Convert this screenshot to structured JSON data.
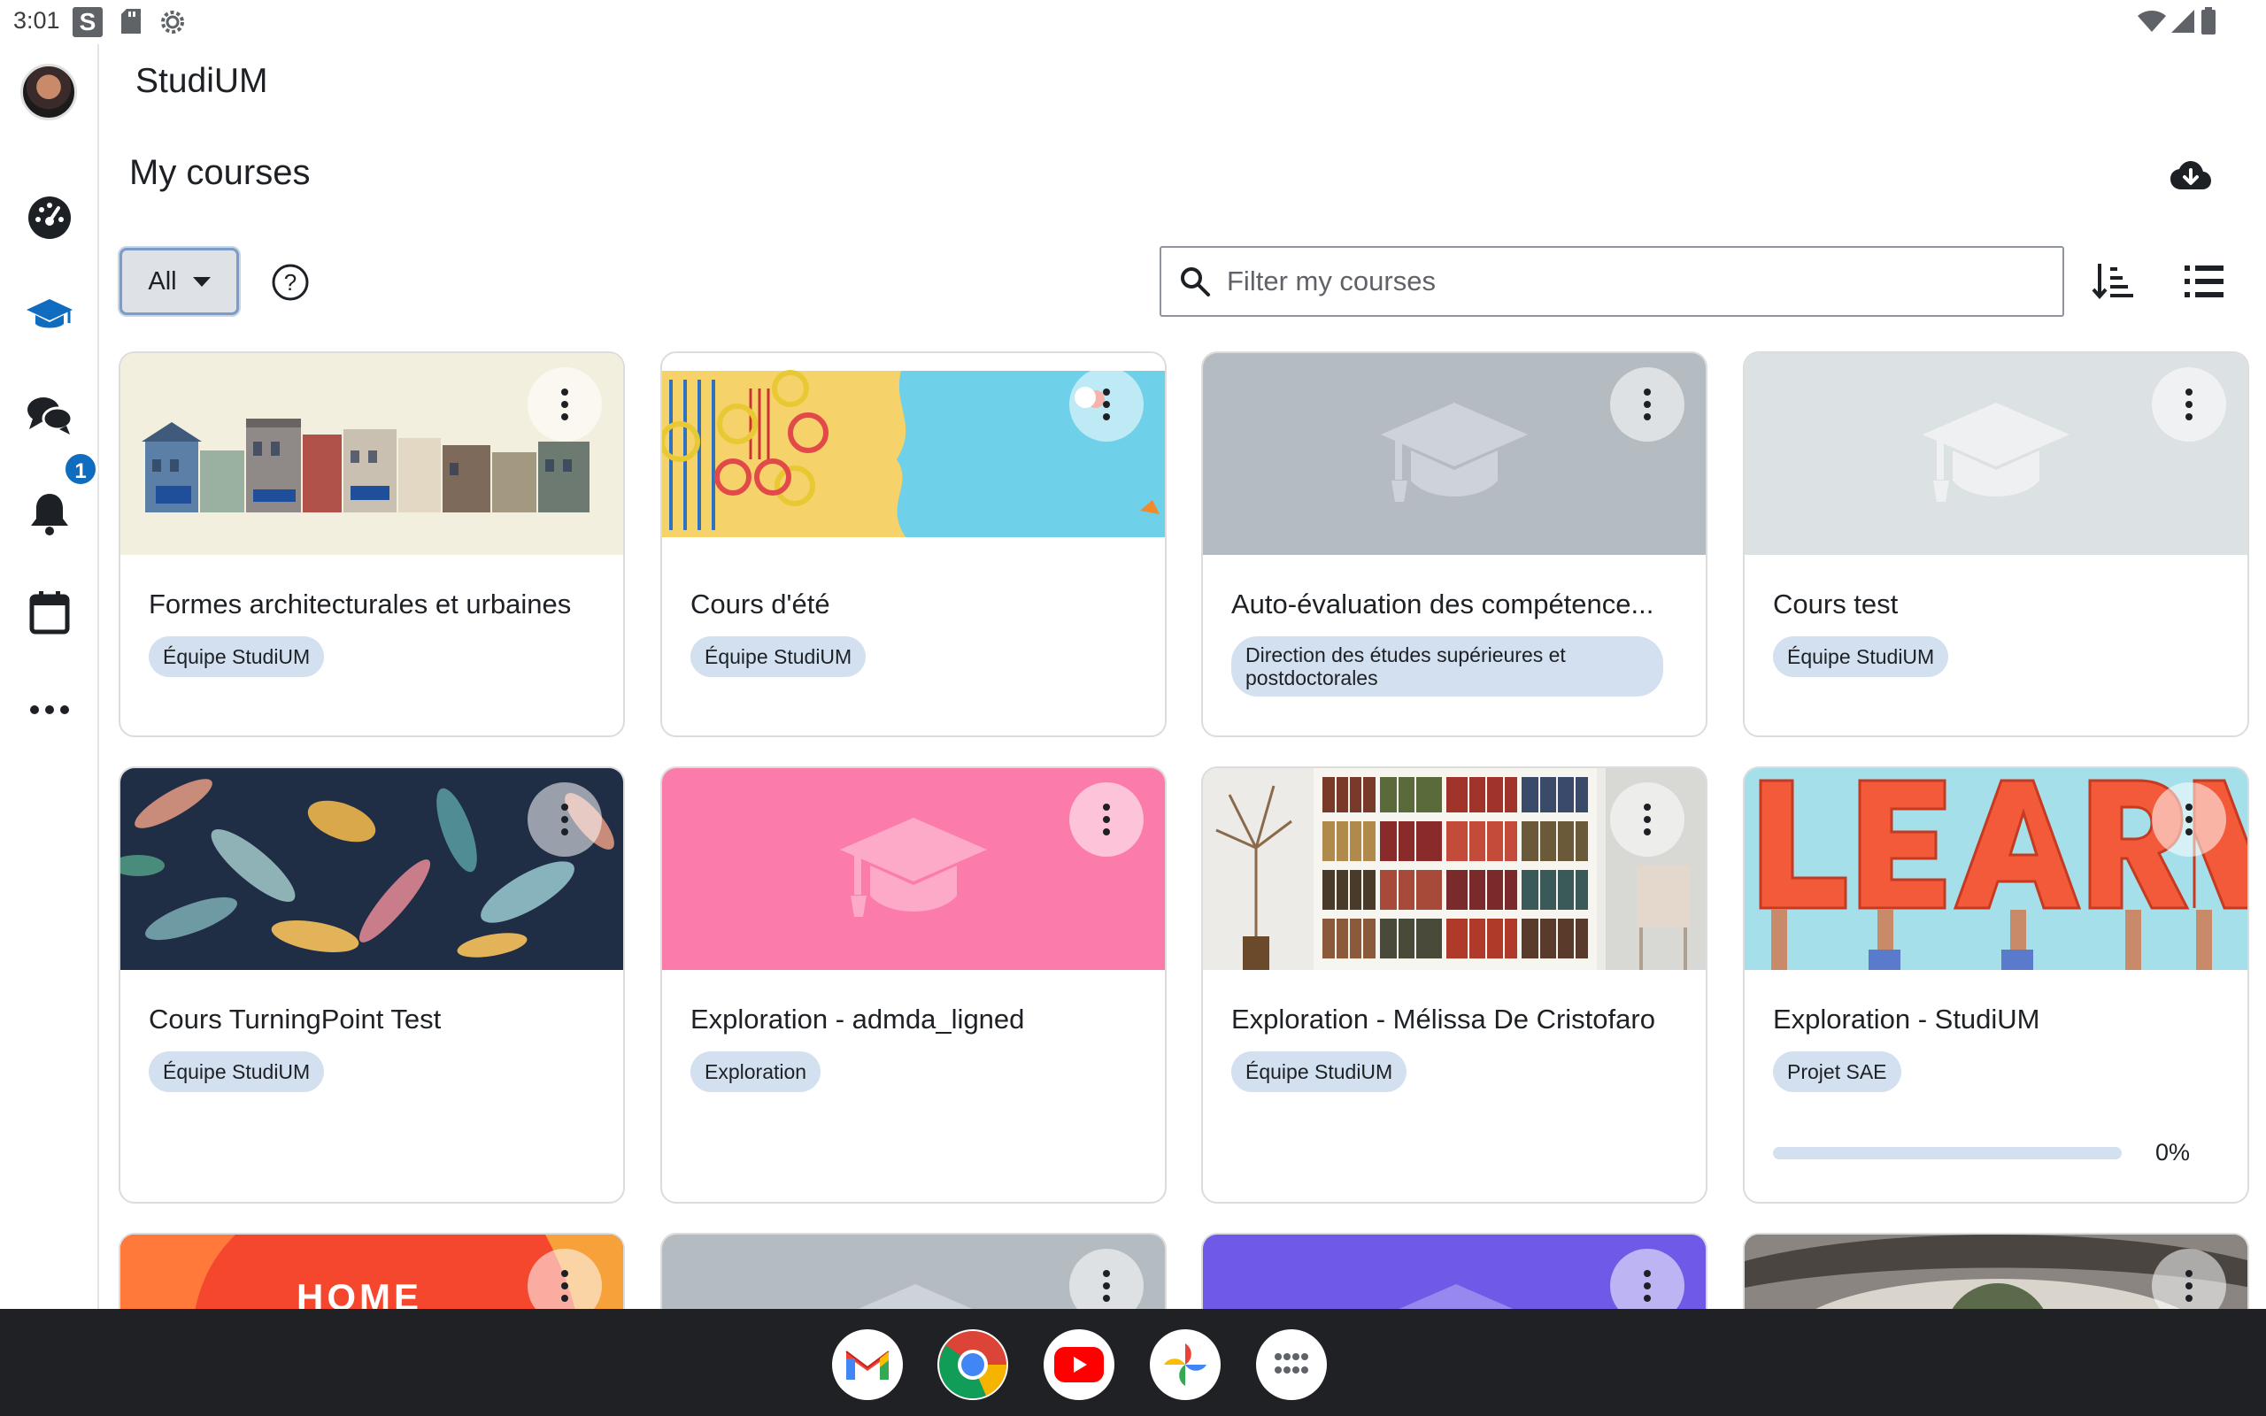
{
  "status_bar": {
    "time": "3:01",
    "s_icon_letter": "S"
  },
  "app": {
    "title": "StudiUM"
  },
  "sidebar": {
    "items": [
      {
        "name": "avatar"
      },
      {
        "name": "dashboard-icon"
      },
      {
        "name": "my-courses-icon",
        "active": true
      },
      {
        "name": "messages-icon"
      },
      {
        "name": "notifications-icon",
        "badge": "1"
      },
      {
        "name": "calendar-icon"
      },
      {
        "name": "more-icon"
      }
    ],
    "notification_badge": "1",
    "active_color": "#0f6cbf"
  },
  "page": {
    "title": "My courses"
  },
  "filters": {
    "grouping_label": "All",
    "search_placeholder": "Filter my courses"
  },
  "courses": [
    {
      "title": "Formes architecturales et urbaines",
      "category": "Équipe StudiUM",
      "image": "buildings"
    },
    {
      "title": "Cours d'été",
      "category": "Équipe StudiUM",
      "image": "beach"
    },
    {
      "title": "Auto-évaluation des compétences",
      "title_display": "Auto-évaluation des compétence...",
      "category": "Direction des études supérieures et postdoctorales",
      "image": "cap-grey"
    },
    {
      "title": "Cours test",
      "category": "Équipe StudiUM",
      "image": "cap-lightgrey"
    },
    {
      "title": "Cours TurningPoint Test",
      "category": "Équipe StudiUM",
      "image": "leaves"
    },
    {
      "title": "Exploration - admda_ligned",
      "category": "Exploration",
      "image": "cap-pink"
    },
    {
      "title": "Exploration - Mélissa De Cristofaro",
      "category": "Équipe StudiUM",
      "image": "bookshelf"
    },
    {
      "title": "Exploration - StudiUM",
      "category": "Projet SAE",
      "image": "learn",
      "progress_label": "0%",
      "progress": 0
    },
    {
      "image": "home",
      "image_text": "HOME"
    },
    {
      "image": "cap-grey"
    },
    {
      "image": "cap-purple"
    },
    {
      "image": "eye"
    }
  ],
  "colors": {
    "category_chip": "#d3e0ef",
    "cap_pink": "#fb7bab",
    "cap_grey": "#b4bcc2",
    "cap_lightgrey": "#dce1e4",
    "cap_purple": "#6e5ae6",
    "taskbar": "#202124"
  },
  "taskbar": {
    "apps": [
      {
        "name": "gmail-icon"
      },
      {
        "name": "chrome-icon"
      },
      {
        "name": "youtube-icon"
      },
      {
        "name": "photos-icon"
      },
      {
        "name": "app-launcher-icon"
      }
    ]
  }
}
